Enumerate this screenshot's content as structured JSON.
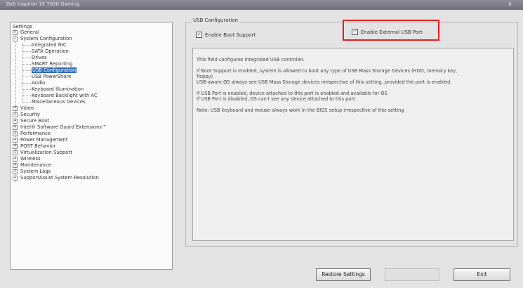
{
  "window": {
    "title": "Dell Inspiron 15 7000 Gaming",
    "close_glyph": "x"
  },
  "tree": {
    "root": "Settings",
    "general": "General",
    "system_configuration": "System Configuration",
    "children": [
      "Integrated NIC",
      "SATA Operation",
      "Drives",
      "SMART Reporting",
      "USB Configuration",
      "USB PowerShare",
      "Audio",
      "Keyboard Illumination",
      "Keyboard Backlight with AC",
      "Miscellaneous Devices"
    ],
    "categories": [
      "Video",
      "Security",
      "Secure Boot",
      "Intel® Software Guard Extensions™",
      "Performance",
      "Power Management",
      "POST Behavior",
      "Virtualization Support",
      "Wireless",
      "Maintenance",
      "System Logs",
      "SupportAssist System Resolution"
    ],
    "expand_glyph": "+",
    "collapse_glyph": "−"
  },
  "panel": {
    "group_title": "USB Configuration",
    "enable_boot_support": {
      "label": "Enable Boot Support",
      "checked": true,
      "mark": "✓"
    },
    "enable_external_usb": {
      "label": "Enable External USB Port",
      "checked": true,
      "mark": "✓"
    },
    "help_lines": [
      "This field configures integrated USB controller.",
      "If Boot Support is enabled, system is allowed to boot any type of USB Mass Storage Devices (HDD, memory key,",
      "floppy).",
      "USB-aware OS always see USB Mass Storage devices irrespective of this setting, provided the port is enabled.",
      "If USB Port is enabled, device attached to this port is enabled and available for OS",
      "If USB Port is disabled, OS can't see any device attached to this port",
      "Note: USB keyboard and mouse always work in the BIOS setup irrespective of this setting"
    ]
  },
  "buttons": {
    "restore": "Restore Settings",
    "apply": "",
    "exit": "Exit"
  },
  "colors": {
    "selection": "#2f6eb3",
    "highlight_box": "#e02020"
  }
}
